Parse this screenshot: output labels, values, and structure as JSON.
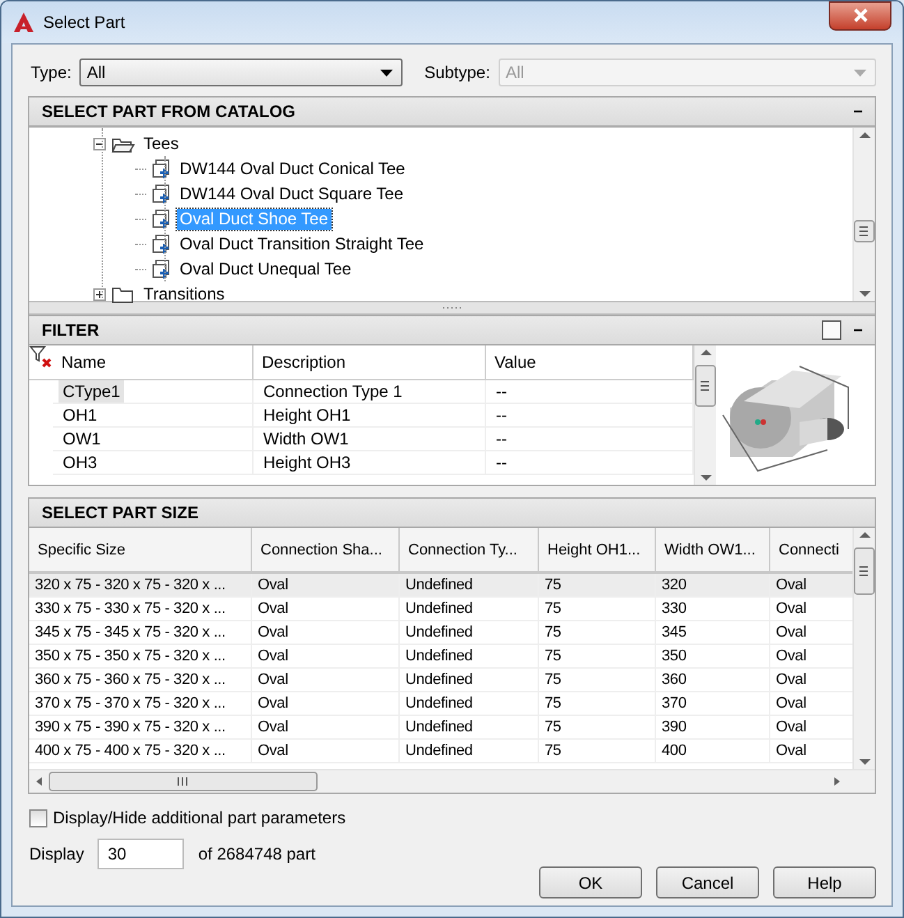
{
  "window": {
    "title": "Select Part"
  },
  "type_row": {
    "type_label": "Type:",
    "type_value": "All",
    "subtype_label": "Subtype:",
    "subtype_value": "All",
    "subtype_disabled": true
  },
  "catalog": {
    "title": "SELECT PART FROM CATALOG",
    "collapse": "−",
    "tree": [
      {
        "label": "Tees",
        "kind": "folder",
        "expanded": true,
        "selected": false,
        "children": [
          {
            "label": "DW144 Oval Duct Conical Tee",
            "kind": "part",
            "selected": false
          },
          {
            "label": "DW144 Oval Duct Square Tee",
            "kind": "part",
            "selected": false
          },
          {
            "label": "Oval Duct Shoe Tee",
            "kind": "part",
            "selected": true
          },
          {
            "label": "Oval Duct Transition Straight Tee",
            "kind": "part",
            "selected": false
          },
          {
            "label": "Oval Duct Unequal Tee",
            "kind": "part",
            "selected": false
          }
        ]
      },
      {
        "label": "Transitions",
        "kind": "folder",
        "expanded": false,
        "selected": false
      }
    ]
  },
  "filter": {
    "title": "FILTER",
    "collapse": "−",
    "columns": [
      "Name",
      "Description",
      "Value"
    ],
    "rows": [
      {
        "cells": [
          "CType1",
          "Connection Type 1",
          "--"
        ],
        "selected": true
      },
      {
        "cells": [
          "OH1",
          "Height OH1",
          "--"
        ],
        "selected": false
      },
      {
        "cells": [
          "OW1",
          "Width OW1",
          "--"
        ],
        "selected": false
      },
      {
        "cells": [
          "OH3",
          "Height OH3",
          "--"
        ],
        "selected": false
      }
    ]
  },
  "part_size": {
    "title": "SELECT PART SIZE",
    "columns": [
      "Specific Size",
      "Connection Sha...",
      "Connection Ty...",
      "Height OH1...",
      "Width OW1...",
      "Connecti"
    ],
    "rows": [
      {
        "cells": [
          "320 x 75 - 320 x 75 - 320 x ...",
          "Oval",
          "Undefined",
          "75",
          "320",
          "Oval"
        ],
        "selected": true
      },
      {
        "cells": [
          "330 x 75 - 330 x 75 - 320 x ...",
          "Oval",
          "Undefined",
          "75",
          "330",
          "Oval"
        ],
        "selected": false
      },
      {
        "cells": [
          "345 x 75 - 345 x 75 - 320 x ...",
          "Oval",
          "Undefined",
          "75",
          "345",
          "Oval"
        ],
        "selected": false
      },
      {
        "cells": [
          "350 x 75 - 350 x 75 - 320 x ...",
          "Oval",
          "Undefined",
          "75",
          "350",
          "Oval"
        ],
        "selected": false
      },
      {
        "cells": [
          "360 x 75 - 360 x 75 - 320 x ...",
          "Oval",
          "Undefined",
          "75",
          "360",
          "Oval"
        ],
        "selected": false
      },
      {
        "cells": [
          "370 x 75 - 370 x 75 - 320 x ...",
          "Oval",
          "Undefined",
          "75",
          "370",
          "Oval"
        ],
        "selected": false
      },
      {
        "cells": [
          "390 x 75 - 390 x 75 - 320 x ...",
          "Oval",
          "Undefined",
          "75",
          "390",
          "Oval"
        ],
        "selected": false
      },
      {
        "cells": [
          "400 x 75 - 400 x 75 - 320 x ...",
          "Oval",
          "Undefined",
          "75",
          "400",
          "Oval"
        ],
        "selected": false
      }
    ]
  },
  "options": {
    "checkbox_label": "Display/Hide additional part parameters",
    "checked": false,
    "display_label": "Display",
    "display_value": "30",
    "display_suffix": "of 2684748 part"
  },
  "buttons": [
    "OK",
    "Cancel",
    "Help"
  ]
}
